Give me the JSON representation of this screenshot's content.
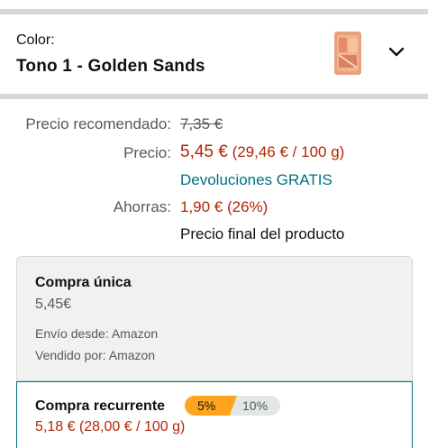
{
  "variation": {
    "label": "Color:",
    "value": "Tono 1 - Golden Sands",
    "swatch_icon": "blush-palette-swatch"
  },
  "pricing": {
    "rrp_label": "Precio recomendado:",
    "rrp_value": "7,35 €",
    "price_label": "Precio:",
    "price_value": "5,45 €",
    "price_unit": "(29,46 € / 100 g)",
    "returns": "Devoluciones GRATIS",
    "savings_label": "Ahorras:",
    "savings_value": "1,90 € (26%)",
    "final_note": "Precio final del producto"
  },
  "one_time": {
    "title": "Compra única",
    "price": "5,45€",
    "ships_from": "Envío desde: Amazon",
    "sold_by": "Vendido por: Amazon"
  },
  "subscribe": {
    "title": "Compra recurrente",
    "discount_a": "5%",
    "discount_b": "10%",
    "price": "5,18 € (28,00 € / 100 g)"
  },
  "colors": {
    "price_red": "#b12704",
    "link_teal": "#007185",
    "badge_orange": "#ffa41c"
  }
}
